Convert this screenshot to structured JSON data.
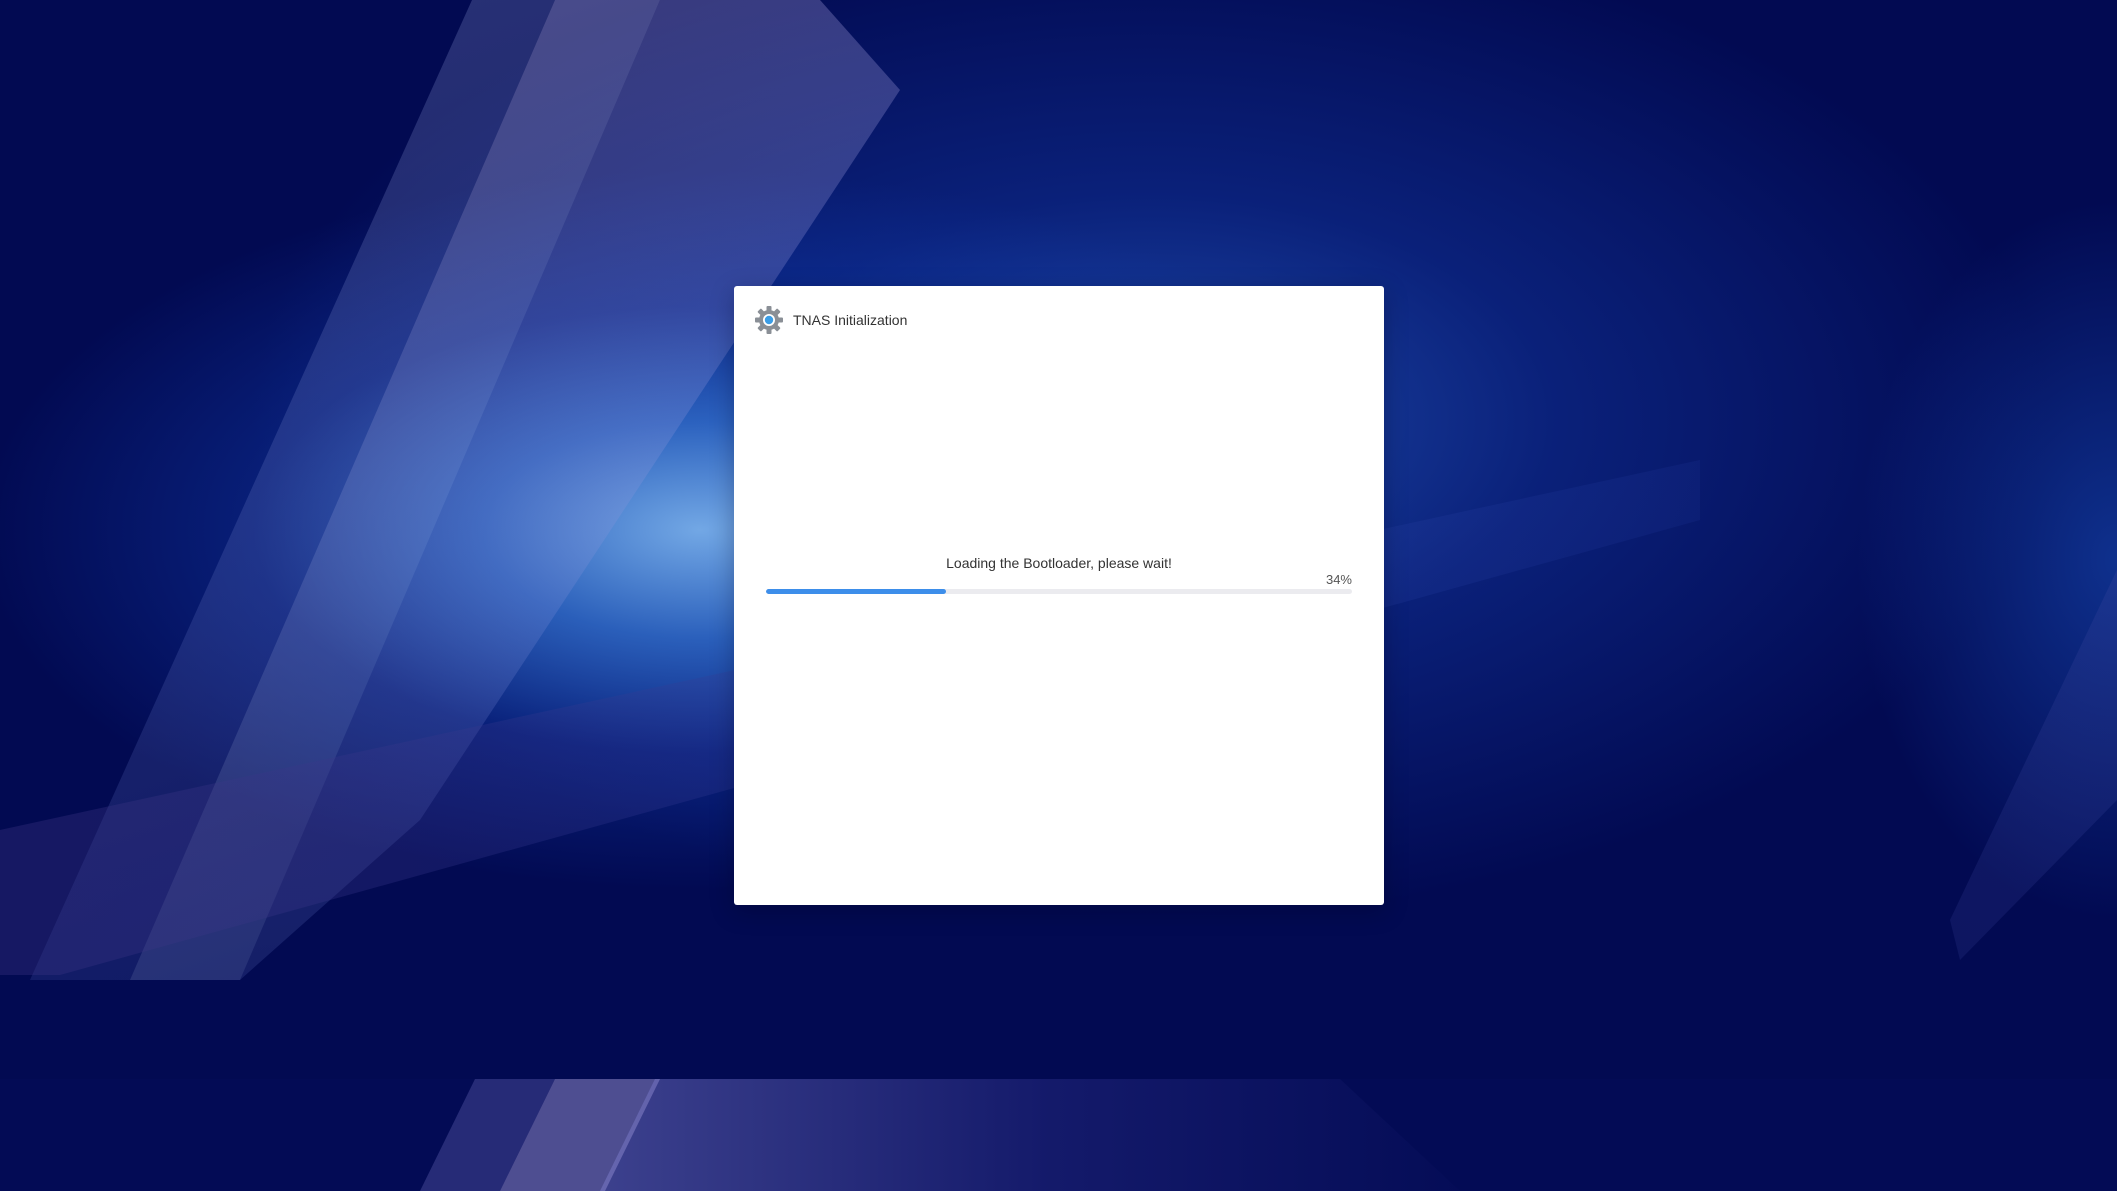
{
  "dialog": {
    "title": "TNAS Initialization",
    "icon": "gear-icon"
  },
  "progress": {
    "message": "Loading the Bootloader, please wait!",
    "percent_label": "34%",
    "bar_fraction": 0.307
  },
  "colors": {
    "background": "#020a52",
    "progress_fill": "#3d8eea",
    "progress_track": "#ebebef",
    "gear_outer": "#8a8f96",
    "gear_inner": "#3b9de6"
  }
}
